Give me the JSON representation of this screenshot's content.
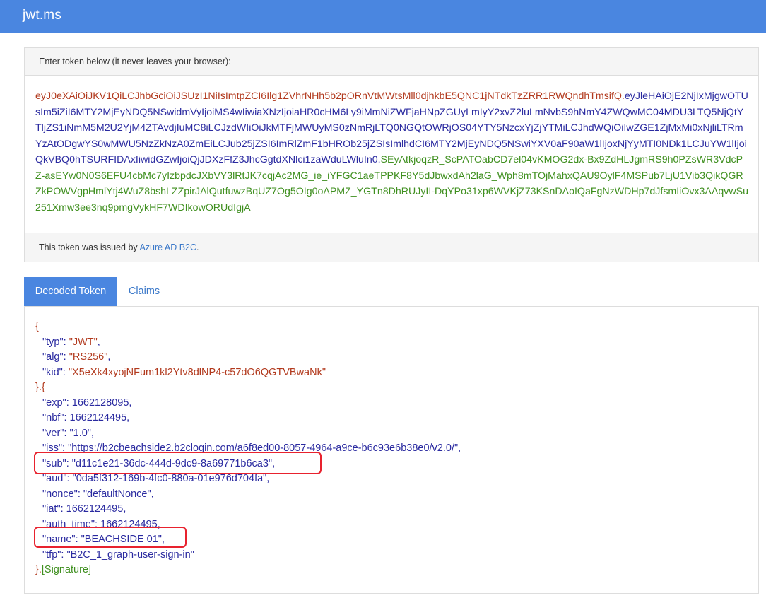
{
  "app": {
    "brand": "jwt.ms"
  },
  "token_panel": {
    "heading": "Enter token below (it never leaves your browser):",
    "token_header": "eyJ0eXAiOiJKV1QiLCJhbGciOiJSUzI1NiIsImtpZCI6Ilg1ZVhrNHh5b2pORnVtMWtsMll0djhkbE5QNC1jNTdkTzZRR1RWQndhTmsifQ.",
    "token_payload": "eyJleHAiOjE2NjIxMjgwOTUsIm5iZiI6MTY2MjEyNDQ5NSwidmVyIjoiMS4wIiwiaXNzIjoiaHR0cHM6Ly9iMmNiZWFjaHNpZGUyLmIyY2xvZ2luLmNvbS9hNmY4ZWQwMC04MDU3LTQ5NjQtYTljZS1iNmM5M2U2YjM4ZTAvdjIuMC8iLCJzdWIiOiJkMTFjMWUyMS0zNmRjLTQ0NGQtOWRjOS04YTY5NzcxYjZjYTMiLCJhdWQiOiIwZGE1ZjMxMi0xNjliLTRmYzAtODgwYS0wMWU5NzZkNzA0ZmEiLCJub25jZSI6ImRlZmF1bHROb25jZSIsImlhdCI6MTY2MjEyNDQ5NSwiYXV0aF90aW1lIjoxNjYyMTI0NDk1LCJuYW1lIjoiQkVBQ0hTSURFIDAxIiwidGZwIjoiQjJDXzFfZ3JhcGgtdXNlci1zaWduLWluIn0.",
    "token_signature": "SEyAtkjoqzR_ScPATOabCD7el04vKMOG2dx-Bx9ZdHLJgmRS9h0PZsWR3VdcPZ-asEYw0N0S6EFU4cbMc7yIzbpdcJXbVY3lRtJK7cqjAc2MG_ie_iYFGC1aeTPPKF8Y5dJbwxdAh2laG_Wph8mTOjMahxQAU9OylF4MSPub7LjU1Vib3QikQGRZkPOWVgpHmlYtj4WuZ8bshLZZpirJAlQutfuwzBqUZ7Og5OIg0oAPMZ_YGTn8DhRUJyII-DqYPo31xp6WVKjZ73KSnDAoIQaFgNzWDHp7dJfsmIiOvx3AAqvwSu251Xmw3ee3nq9pmgVykHF7WDIkowORUdIgjA",
    "footer_prefix": "This token was issued by ",
    "footer_link": "Azure AD B2C",
    "footer_suffix": "."
  },
  "tabs": {
    "decoded": "Decoded Token",
    "claims": "Claims"
  },
  "decoded": {
    "open_brace": "{",
    "header_close": "}.{",
    "payload_close": "}.",
    "signature_label": "[Signature]",
    "header_fields": [
      {
        "key": "\"typ\"",
        "value": "\"JWT\""
      },
      {
        "key": "\"alg\"",
        "value": "\"RS256\""
      },
      {
        "key": "\"kid\"",
        "value": "\"X5eXk4xyojNFum1kl2Ytv8dlNP4-c57dO6QGTVBwaNk\""
      }
    ],
    "payload_fields": [
      {
        "key": "\"exp\"",
        "value": "1662128095,"
      },
      {
        "key": "\"nbf\"",
        "value": "1662124495,"
      },
      {
        "key": "\"ver\"",
        "value": "\"1.0\","
      },
      {
        "key": "\"iss\"",
        "value": "\"https://b2cbeachside2.b2clogin.com/a6f8ed00-8057-4964-a9ce-b6c93e6b38e0/v2.0/\","
      },
      {
        "key": "\"sub\"",
        "value": "\"d11c1e21-36dc-444d-9dc9-8a69771b6ca3\","
      },
      {
        "key": "\"aud\"",
        "value": "\"0da5f312-169b-4fc0-880a-01e976d704fa\","
      },
      {
        "key": "\"nonce\"",
        "value": "\"defaultNonce\","
      },
      {
        "key": "\"iat\"",
        "value": "1662124495,"
      },
      {
        "key": "\"auth_time\"",
        "value": "1662124495,"
      },
      {
        "key": "\"name\"",
        "value": "\"BEACHSIDE 01\","
      },
      {
        "key": "\"tfp\"",
        "value": "\"B2C_1_graph-user-sign-in\""
      }
    ]
  },
  "colors": {
    "brand": "#4a86e0",
    "highlight": "#e8222e",
    "header_text": "#b23a1e",
    "payload_text": "#2a2aa0",
    "signature_text": "#3f8f1f"
  }
}
